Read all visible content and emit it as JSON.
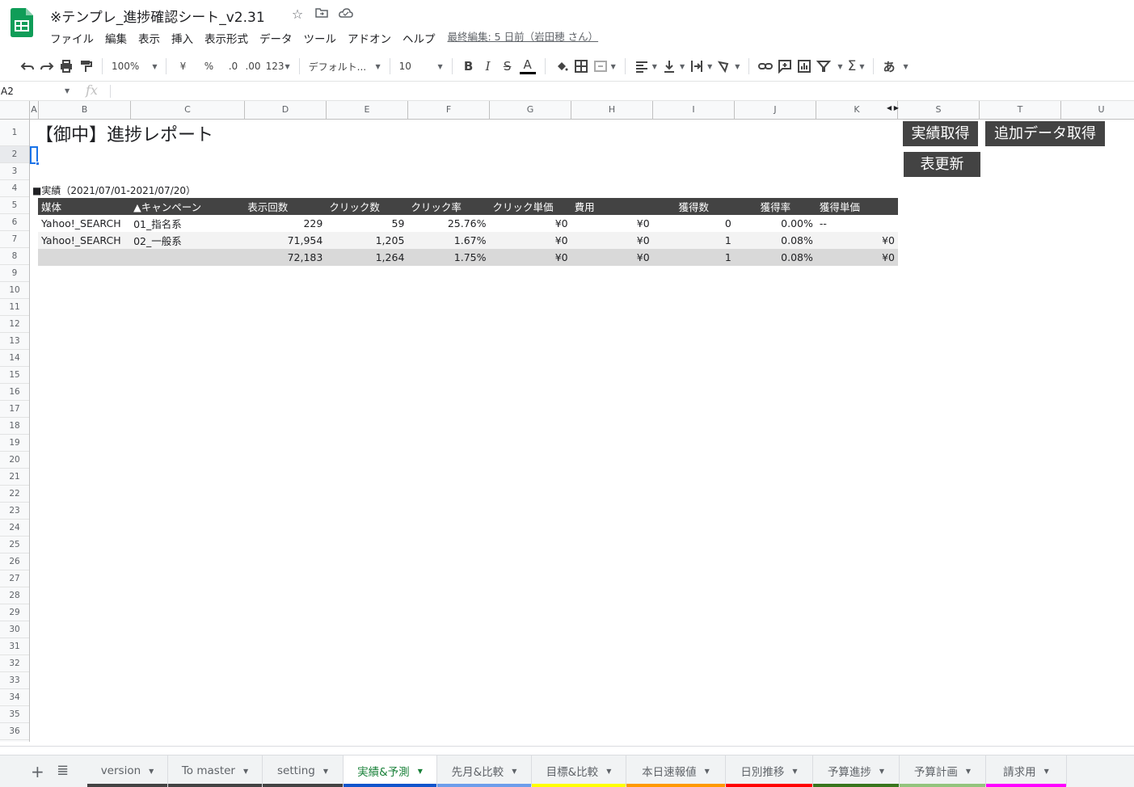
{
  "app": {
    "doc_title": "※テンプレ_進捗確認シート_v2.31",
    "menu": [
      "ファイル",
      "編集",
      "表示",
      "挿入",
      "表示形式",
      "データ",
      "ツール",
      "アドオン",
      "ヘルプ"
    ],
    "last_edit": "最終編集: 5 日前（岩田穂 さん）"
  },
  "toolbar": {
    "zoom": "100%",
    "currency": "¥",
    "percent": "%",
    "decimal_decrease": ".0",
    "decimal_increase": ".00",
    "more_formats": "123",
    "font": "デフォルト...",
    "font_size": "10",
    "bold": "B",
    "italic": "I",
    "strike": "S",
    "text_color": "A",
    "input_tools": "あ"
  },
  "formula_bar": {
    "name_box": "A2",
    "fx": "fx",
    "value": ""
  },
  "grid": {
    "columns_left": [
      "A",
      "B",
      "C",
      "D",
      "E",
      "F",
      "G",
      "H",
      "I",
      "J",
      "K"
    ],
    "columns_right": [
      "S",
      "T",
      "U"
    ],
    "rows": [
      "1",
      "2",
      "3",
      "4",
      "5",
      "6",
      "7",
      "8",
      "9",
      "10",
      "11",
      "12",
      "13",
      "14",
      "15",
      "16",
      "17",
      "18",
      "19",
      "20",
      "21",
      "22",
      "23",
      "24",
      "25",
      "26",
      "27",
      "28",
      "29",
      "30",
      "31",
      "32",
      "33",
      "34",
      "35",
      "36"
    ]
  },
  "sheet": {
    "title": "【御中】進捗レポート",
    "section_label": "■実績（2021/07/01-2021/07/20）",
    "table": {
      "headers": [
        "媒体",
        "▲キャンペーン",
        "表示回数",
        "クリック数",
        "クリック率",
        "クリック単価",
        "費用",
        "獲得数",
        "獲得率",
        "獲得単価"
      ],
      "rows": [
        [
          "Yahoo!_SEARCH",
          "01_指名系",
          "229",
          "59",
          "25.76%",
          "¥0",
          "¥0",
          "0",
          "0.00%",
          "--"
        ],
        [
          "Yahoo!_SEARCH",
          "02_一般系",
          "71,954",
          "1,205",
          "1.67%",
          "¥0",
          "¥0",
          "1",
          "0.08%",
          "¥0"
        ],
        [
          "",
          "",
          "72,183",
          "1,264",
          "1.75%",
          "¥0",
          "¥0",
          "1",
          "0.08%",
          "¥0"
        ]
      ]
    },
    "buttons": {
      "fetch_actuals": "実績取得",
      "fetch_additional": "追加データ取得",
      "refresh_table": "表更新"
    }
  },
  "tabs": [
    {
      "label": "version",
      "color": "#434343",
      "active": false
    },
    {
      "label": "To master",
      "color": "#434343",
      "active": false
    },
    {
      "label": "setting",
      "color": "#434343",
      "active": false
    },
    {
      "label": "実績&予測",
      "color": "#1155cc",
      "active": true
    },
    {
      "label": "先月&比較",
      "color": "#6d9eeb",
      "active": false
    },
    {
      "label": "目標&比較",
      "color": "#ffff00",
      "active": false
    },
    {
      "label": "本日速報値",
      "color": "#ff9900",
      "active": false
    },
    {
      "label": "日別推移",
      "color": "#ff0000",
      "active": false
    },
    {
      "label": "予算進捗",
      "color": "#38761d",
      "active": false
    },
    {
      "label": "予算計画",
      "color": "#93c47d",
      "active": false
    },
    {
      "label": "請求用",
      "color": "#ff00ff",
      "active": false
    }
  ],
  "colors": {
    "header_bg": "#434343",
    "accent": "#1a73e8",
    "active_tab_text": "#188038",
    "logo_green": "#0f9d58"
  }
}
